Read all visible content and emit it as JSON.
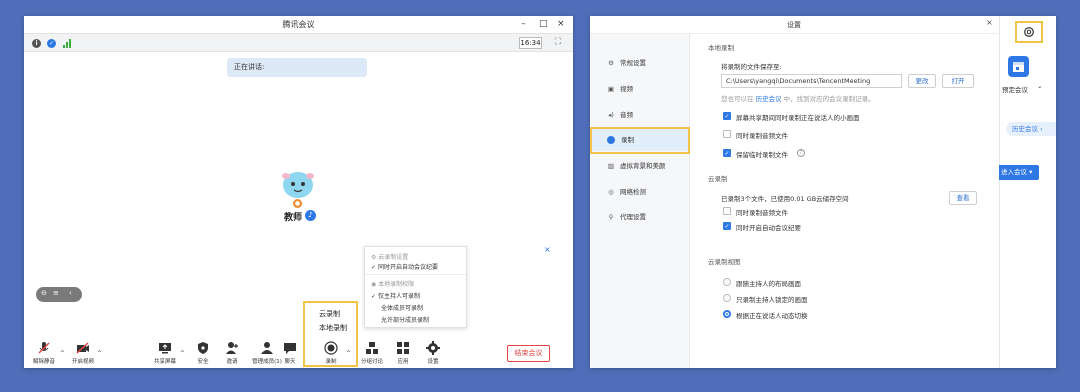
{
  "left_window": {
    "title": "腾讯会议",
    "controls": {
      "minimize": "–",
      "maximize": "□",
      "close": "×"
    },
    "clock": "16:34",
    "speaking_label": "正在讲话:",
    "participant_name": "教师",
    "view_toggle": {
      "left": "⊖",
      "mid": "≡",
      "right": "‹"
    },
    "popup": {
      "cloud_header": "云录制设置",
      "cloud_opt": "同时开启自动会议纪要",
      "local_header": "本地录制权限",
      "local_opts": [
        "仅主持人可录制",
        "全体成员可录制",
        "允许部分成员录制"
      ]
    },
    "record_menu": {
      "cloud": "云录制",
      "local": "本地录制"
    },
    "toolbar": {
      "mute": "解除静音",
      "video": "开启视频",
      "share": "共享屏幕",
      "security": "安全",
      "invite": "邀请",
      "members": "管理成员(1)",
      "chat": "聊天",
      "record": "录制",
      "breakout": "分组讨论",
      "apps": "应用",
      "settings": "设置"
    },
    "end_button": "结束会议"
  },
  "settings": {
    "title": "设置",
    "close": "×",
    "nav": [
      {
        "icon": "⚙",
        "label": "常规设置"
      },
      {
        "icon": "▣",
        "label": "视频"
      },
      {
        "icon": "◂)",
        "label": "音频"
      },
      {
        "icon": "",
        "label": "录制"
      },
      {
        "icon": "▨",
        "label": "虚拟背景和美颜"
      },
      {
        "icon": "◎",
        "label": "网络检测"
      },
      {
        "icon": "⚲",
        "label": "代理设置"
      }
    ],
    "local_section": "本地录制",
    "save_to_label": "将录制的文件保存至:",
    "path_value": "C:\\Users\\yangqi\\Documents\\TencentMeeting",
    "change_btn": "更改",
    "open_btn": "打开",
    "hint_prefix": "您也可以在",
    "hint_link": "历史会议",
    "hint_suffix": "中，找到对应的会议录制记录。",
    "local_options": [
      {
        "label": "屏幕共享期间同时录制正在说话人的小画面",
        "checked": true
      },
      {
        "label": "同时录制音频文件",
        "checked": false
      },
      {
        "label": "保留临时录制文件",
        "checked": true
      }
    ],
    "cloud_section": "云录制",
    "cloud_usage": "已录制3个文件，已使用0.01 GB云储存空间",
    "view_btn": "查看",
    "cloud_options": [
      {
        "label": "同时录制音频文件",
        "checked": false
      },
      {
        "label": "同时开启自动会议纪要",
        "checked": true
      }
    ],
    "view_section": "云录制视图",
    "view_options": [
      {
        "label": "跟随主持人的布局画面",
        "selected": false
      },
      {
        "label": "只录制主持人锁定的画面",
        "selected": false
      },
      {
        "label": "根据正在说话人动态切换",
        "selected": true
      }
    ]
  },
  "main_strip": {
    "schedule_label": "预定会议",
    "schedule_caret": "⌄",
    "history_btn": "历史会议 ›",
    "join_btn": "进入会议 ▾"
  },
  "colors": {
    "background": "#4f6db8",
    "accent": "#2e78e6",
    "highlight": "#f3c24a",
    "end_red": "#e54545"
  }
}
